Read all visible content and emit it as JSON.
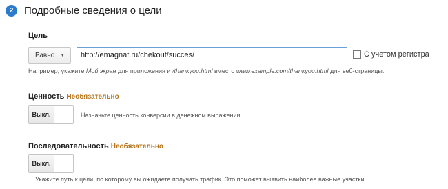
{
  "header": {
    "step_number": "2",
    "title": "Подробные сведения о цели"
  },
  "goal": {
    "label": "Цель",
    "match_type": "Равно",
    "url_value": "http://emagnat.ru/chekout/succes/",
    "case_sensitive_label": "С учетом регистра",
    "case_sensitive_checked": false,
    "hint_prefix": "Например, укажите ",
    "hint_app": "Мой экран",
    "hint_mid": " для приложения и ",
    "hint_path": "/thankyou.html",
    "hint_instead": " вместо ",
    "hint_example": "www.example.com/thankyou.html",
    "hint_suffix": " для веб-страницы."
  },
  "value": {
    "label": "Ценность",
    "optional": "Необязательно",
    "toggle_label": "Выкл.",
    "hint": "Назначьте ценность конверсии в денежном выражении."
  },
  "sequence": {
    "label": "Последовательность",
    "optional": "Необязательно",
    "toggle_label": "Выкл.",
    "hint": "Укажите путь к цели, по которому вы ожидаете получать трафик. Это поможет выявить наиболее важные участки."
  },
  "colors": {
    "accent": "#2b7bcc",
    "optional": "#b5731a"
  }
}
